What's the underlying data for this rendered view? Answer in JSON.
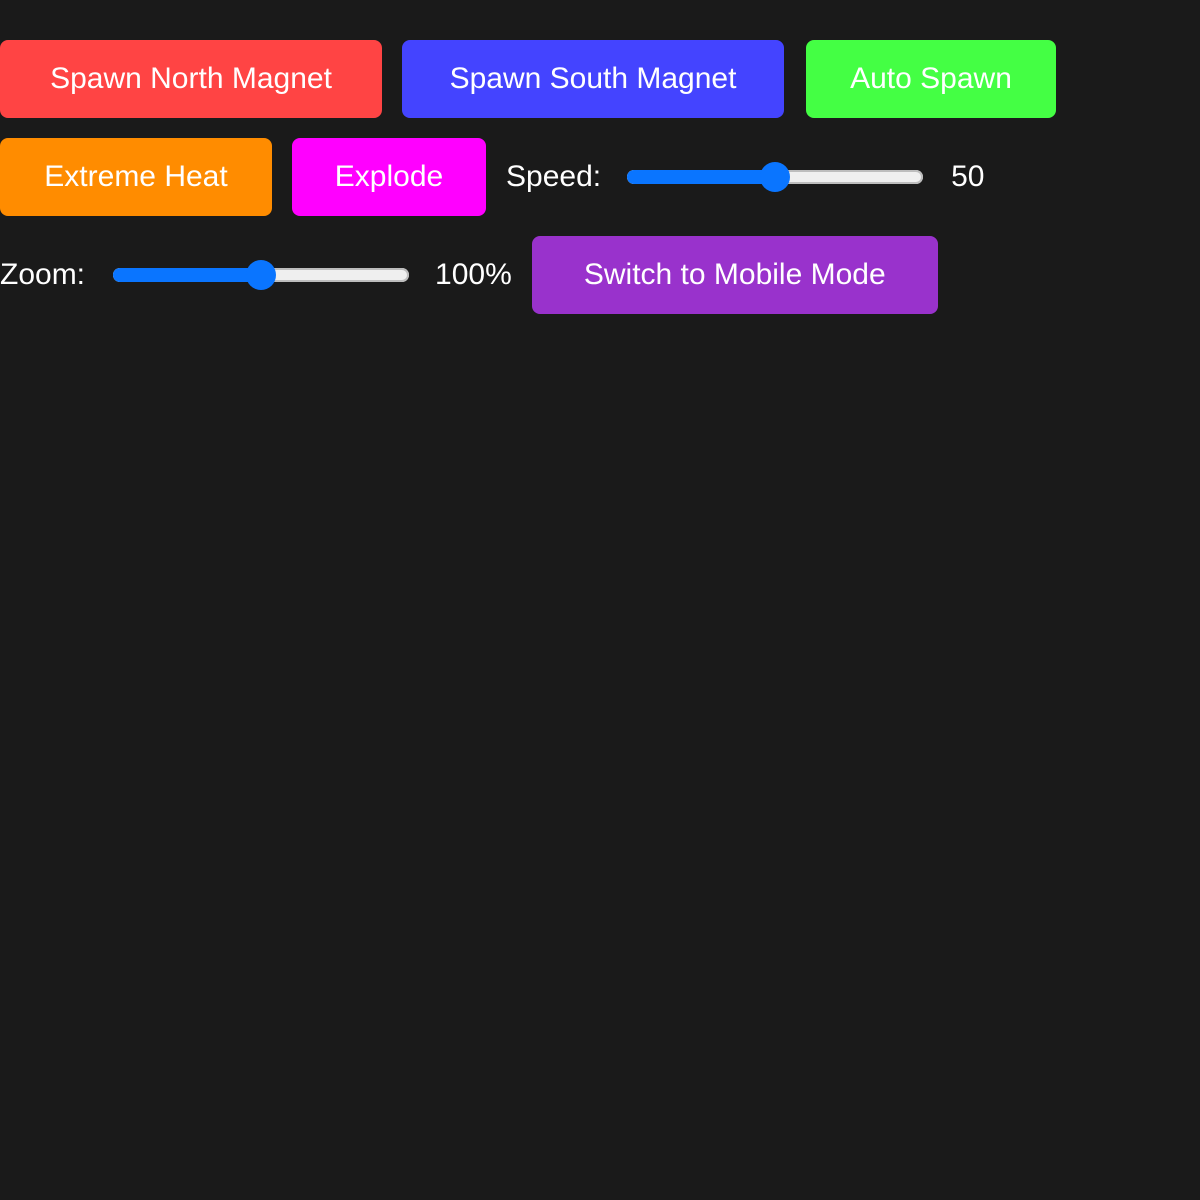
{
  "buttons": {
    "spawn_north": {
      "label": "Spawn North Magnet",
      "color": "#ff4444"
    },
    "spawn_south": {
      "label": "Spawn South Magnet",
      "color": "#4444ff"
    },
    "auto_spawn": {
      "label": "Auto Spawn",
      "color": "#44ff44"
    },
    "extreme_heat": {
      "label": "Extreme Heat",
      "color": "#ff8c00"
    },
    "explode": {
      "label": "Explode",
      "color": "#ff00ff"
    },
    "mobile_mode": {
      "label": "Switch to Mobile Mode",
      "color": "#9932cc"
    }
  },
  "speed": {
    "label": "Speed:",
    "value": 50,
    "display": "50",
    "min": 0,
    "max": 100
  },
  "zoom": {
    "label": "Zoom:",
    "value": 100,
    "display": "100%",
    "min": 0,
    "max": 200
  },
  "colors": {
    "background": "#1a1a1a",
    "slider_accent": "#0a75ff",
    "slider_track": "#efefef"
  }
}
